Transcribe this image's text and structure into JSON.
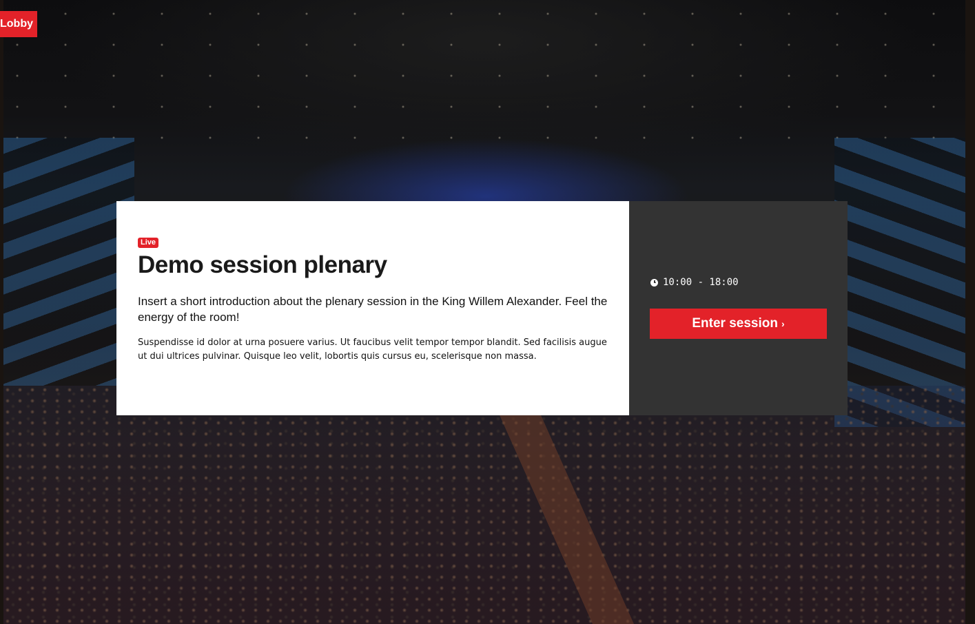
{
  "nav": {
    "lobby_label": "Lobby"
  },
  "session": {
    "status_badge": "Live",
    "title": "Demo session plenary",
    "intro": "Insert a short introduction about the plenary session in the King Willem Alexander. Feel the energy of the room!",
    "description": "Suspendisse id dolor at urna posuere varius. Ut faucibus velit tempor tempor blandit. Sed facilisis augue ut dui ultrices pulvinar. Quisque leo velit, lobortis quis cursus eu, scelerisque non massa.",
    "time": "10:00 - 18:00",
    "enter_label": "Enter session",
    "enter_chevron": "›"
  },
  "colors": {
    "accent": "#e32229",
    "side_panel": "#333333",
    "card": "#ffffff"
  },
  "icons": {
    "time": "clock-icon",
    "enter": "chevron-right-icon"
  }
}
